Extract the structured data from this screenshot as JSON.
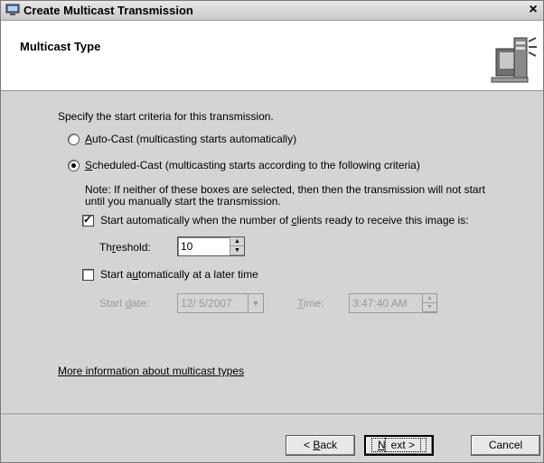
{
  "window": {
    "title": "Create Multicast Transmission",
    "close_label": "×"
  },
  "header": {
    "title": "Multicast Type"
  },
  "content": {
    "intro": "Specify the start criteria for this transmission.",
    "auto_cast": {
      "accel": "A",
      "label_rest": "uto-Cast (multicasting starts automatically)",
      "selected": false
    },
    "scheduled_cast": {
      "accel": "S",
      "label_rest": "cheduled-Cast (multicasting starts according to the following criteria)",
      "selected": true
    },
    "note_line1": "Note: If neither of these boxes are selected, then then the transmission will not start",
    "note_line2": "until you manually start the transmission.",
    "clients_checkbox": {
      "label_pre": "Start automatically when the number of ",
      "accel": "c",
      "label_post": "lients ready to receive this image is:",
      "checked": true
    },
    "threshold": {
      "label_pre": "Th",
      "accel": "r",
      "label_post": "eshold:",
      "value": "10"
    },
    "later_checkbox": {
      "label_pre": "Start a",
      "accel": "u",
      "label_post": "tomatically at a later time",
      "checked": false
    },
    "start_date": {
      "label_pre": "Start ",
      "accel": "d",
      "label_post": "ate:",
      "value": "12/ 5/2007"
    },
    "time": {
      "accel": "T",
      "label_post": "ime:",
      "value": "3:47:40 AM"
    },
    "more_info_link": "More information about multicast types"
  },
  "footer": {
    "back": {
      "pre": "< ",
      "accel": "B",
      "post": "ack"
    },
    "next": {
      "accel": "N",
      "post": "ext >"
    },
    "cancel": "Cancel"
  },
  "icons": {
    "app": "computer-icon",
    "header": "server-multicast-icon",
    "spin_up": "▲",
    "spin_down": "▼",
    "dropdown": "▼",
    "check": "✓"
  }
}
